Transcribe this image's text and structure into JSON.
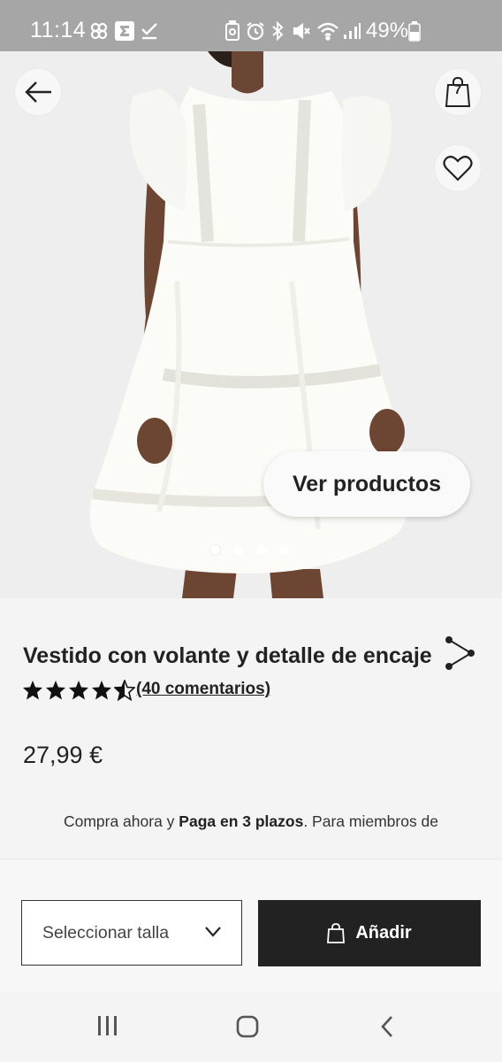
{
  "status_bar": {
    "time": "11:14",
    "battery": "49%"
  },
  "header": {
    "cart_count": "7"
  },
  "hero": {
    "cta_label": "Ver productos",
    "image_count": 4,
    "active_image": 1
  },
  "product": {
    "title": "Vestido con volante y detalle de encaje",
    "rating": 4.5,
    "reviews_label": "(40 comentarios)",
    "price": "27,99 €",
    "promo_prefix": "Compra ahora y ",
    "promo_bold": "Paga en 3 plazos",
    "promo_suffix": ". Para miembros de"
  },
  "purchase": {
    "size_placeholder": "Seleccionar talla",
    "add_label": "Añadir"
  },
  "icons": {
    "back": "arrow-left-icon",
    "cart": "shopping-bag-icon",
    "favorite": "heart-icon",
    "share": "share-icon",
    "star": "star-icon",
    "bag": "bag-icon",
    "chevron": "chevron-down-icon"
  }
}
